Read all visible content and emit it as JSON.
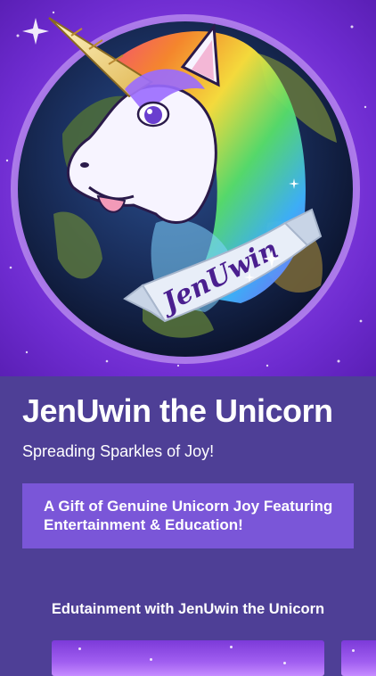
{
  "hero": {
    "banner_text": "JenUwin",
    "icon": "unicorn-globe-logo"
  },
  "header": {
    "title": "JenUwin the Unicorn",
    "subtitle": "Spreading Sparkles of Joy!"
  },
  "promo": {
    "text": "A Gift of Genuine Unicorn Joy Featuring Entertainment & Education!"
  },
  "section": {
    "heading": "Edutainment with JenUwin the Unicorn"
  },
  "colors": {
    "background": "#4e3f96",
    "promo_background": "#7a56d8",
    "hero_purple": "#8a43e6"
  }
}
